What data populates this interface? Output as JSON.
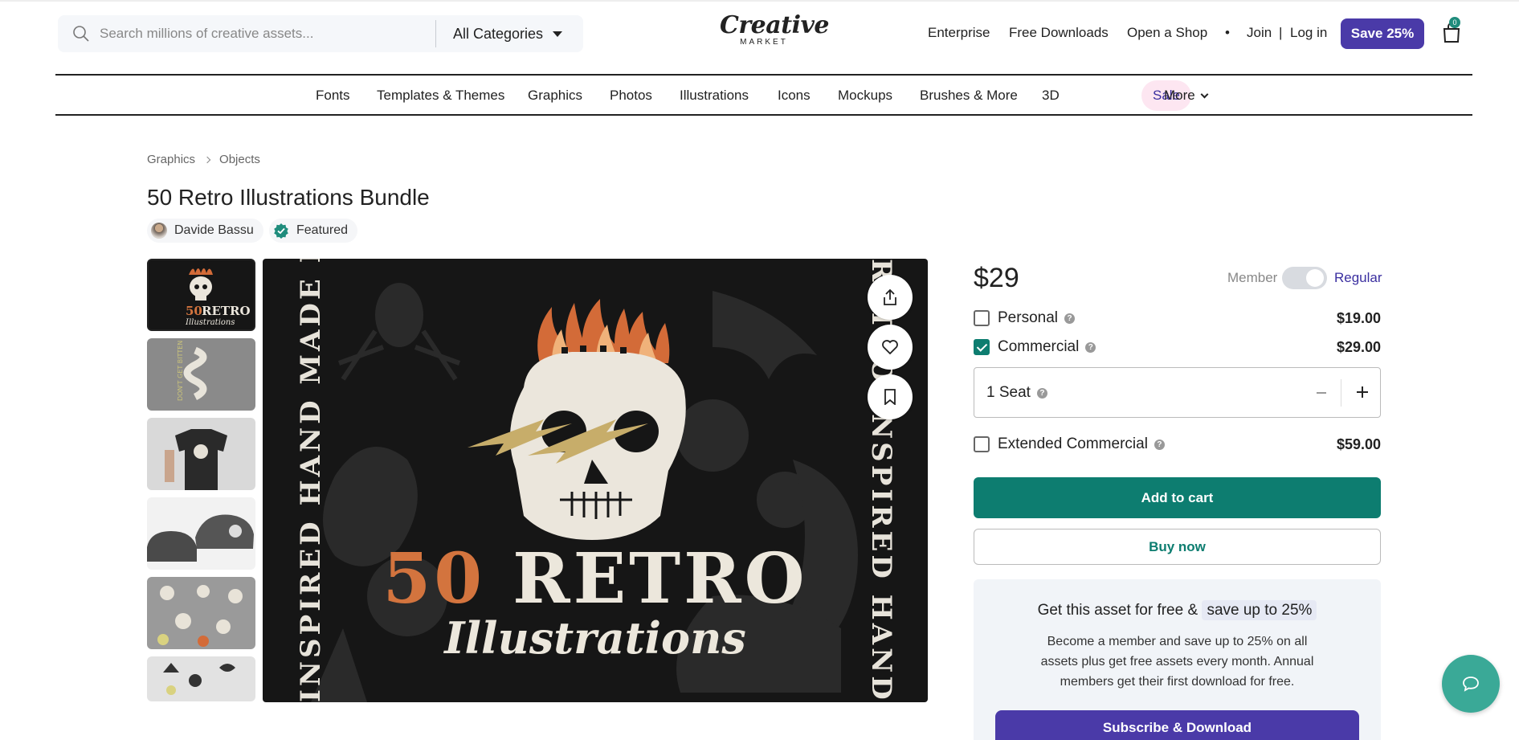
{
  "search": {
    "placeholder": "Search millions of creative assets...",
    "category": "All Categories"
  },
  "logo": {
    "main": "Creative",
    "sub": "MARKET"
  },
  "top_nav": {
    "enterprise": "Enterprise",
    "free_downloads": "Free Downloads",
    "open_shop": "Open a Shop",
    "bullet": "•",
    "join": "Join",
    "divider": "|",
    "login": "Log in",
    "save": "Save 25%",
    "cart_count": "0"
  },
  "category_nav": {
    "items": [
      "Fonts",
      "Templates & Themes",
      "Graphics",
      "Photos",
      "Illustrations",
      "Icons",
      "Mockups",
      "Brushes & More",
      "3D"
    ],
    "sale": "Sale",
    "more": "More"
  },
  "breadcrumb": [
    "Graphics",
    "Objects"
  ],
  "product": {
    "title": "50 Retro Illustrations Bundle",
    "author": "Davide Bassu",
    "badge": "Featured"
  },
  "hero": {
    "line1_num": "50",
    "line1_word": "RETRO",
    "line2": "Illustrations",
    "side_text": "INSPIRED HAND MADE ILLUSTRATIONS",
    "side_text_right": "RETRO INSPIRED HAND MADE ILLUSTR"
  },
  "thumbs": {
    "t1_num": "50",
    "t1_word": "RETRO",
    "t1_sub": "Illustrations",
    "t2_text": "DON'T GET BITTEN"
  },
  "pricing": {
    "price": "$29",
    "member_label": "Member",
    "regular_label": "Regular",
    "licenses": [
      {
        "name": "Personal",
        "price": "$19.00",
        "checked": false
      },
      {
        "name": "Commercial",
        "price": "$29.00",
        "checked": true
      },
      {
        "name": "Extended Commercial",
        "price": "$59.00",
        "checked": false
      }
    ],
    "seats": "1 Seat",
    "help_glyph": "?",
    "add_to_cart": "Add to cart",
    "buy_now": "Buy now"
  },
  "promo": {
    "head": "Get this asset for free &",
    "head_highlight": "save up to 25%",
    "body": "Become a member and save up to 25% on all assets plus get free assets every month. Annual members get their first download for free.",
    "cta": "Subscribe & Download"
  },
  "colors": {
    "brand_purple": "#4a3aa8",
    "brand_teal": "#0d7d70",
    "sale_bg": "#fde6f1",
    "chat_teal": "#3aa997"
  }
}
